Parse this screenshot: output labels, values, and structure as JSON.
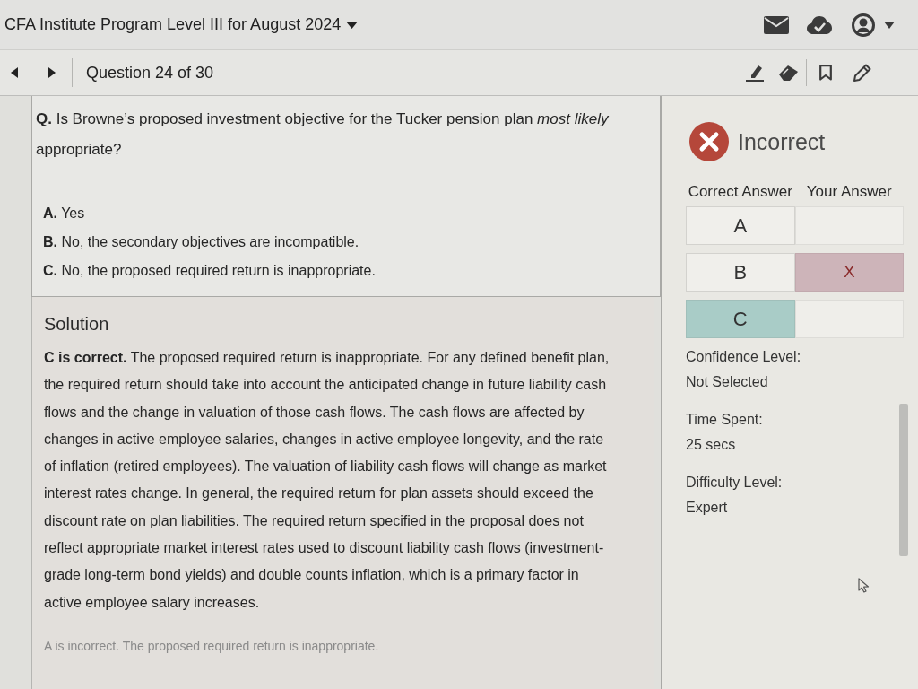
{
  "header": {
    "title": "CFA Institute Program Level III for August 2024"
  },
  "toolbar": {
    "question_counter": "Question 24 of 30"
  },
  "question": {
    "text": "**Q.** Is Browne’s proposed investment objective for the Tucker pension plan *most likely* appropriate?",
    "options": [
      {
        "text": "**A.** Yes"
      },
      {
        "text": "**B.** No, the secondary objectives are incompatible."
      },
      {
        "text": "**C.** No, the proposed required return is inappropriate."
      }
    ]
  },
  "solution": {
    "title": "Solution",
    "paragraphs": [
      {
        "kind": "explanation",
        "text": "**C is correct.** The proposed required return is inappropriate. For any defined benefit plan, the required return should take into account the anticipated change in future liability cash flows and the change in valuation of those cash flows. The cash flows are affected by changes in active employee salaries, changes in active employee longevity, and the rate of inflation (retired employees). The valuation of liability cash flows will change as market interest rates change. In general, the required return for plan assets should exceed the discount rate on plan liabilities. The required return specified in the proposal does not reflect appropriate market interest rates used to discount liability cash flows (investment-grade long-term bond yields) and double counts inflation, which is a primary factor in active employee salary increases."
      },
      {
        "kind": "note",
        "text": "A is incorrect. The proposed required return is inappropriate."
      }
    ]
  },
  "result": {
    "kind": "incorrect",
    "label": "Incorrect"
  },
  "answers": {
    "columns": [
      "Correct Answer",
      "Your Answer"
    ],
    "rows": [
      {
        "option": "A",
        "correct": false,
        "selected": false
      },
      {
        "option": "B",
        "correct": false,
        "selected": true,
        "mark": "X"
      },
      {
        "option": "C",
        "correct": true,
        "selected": false
      }
    ]
  },
  "stats": [
    {
      "label": "Confidence Level:",
      "value": "Not Selected"
    },
    {
      "label": "Time Spent:",
      "value": "25 secs"
    },
    {
      "label": "Difficulty Level:",
      "value": "Expert"
    }
  ]
}
